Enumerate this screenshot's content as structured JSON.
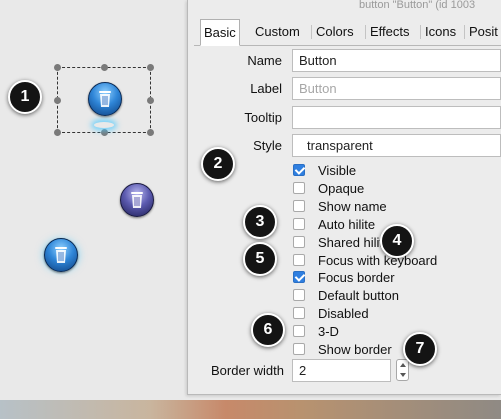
{
  "window": {
    "title": "button \"Button\" (id 1003"
  },
  "tabs": [
    "Basic",
    "Custom",
    "Colors",
    "Effects",
    "Icons",
    "Posit"
  ],
  "active_tab": "Basic",
  "fields": {
    "name": {
      "label": "Name",
      "value": "Button"
    },
    "label": {
      "label": "Label",
      "placeholder": "Button"
    },
    "tooltip": {
      "label": "Tooltip",
      "value": ""
    },
    "style": {
      "label": "Style",
      "value": "transparent"
    },
    "border_width": {
      "label": "Border width",
      "value": "2"
    }
  },
  "checkboxes": [
    {
      "label": "Visible",
      "checked": true
    },
    {
      "label": "Opaque",
      "checked": false
    },
    {
      "label": "Show name",
      "checked": false
    },
    {
      "label": "Auto hilite",
      "checked": false
    },
    {
      "label": "Shared hilite",
      "checked": false
    },
    {
      "label": "Focus with keyboard",
      "checked": false
    },
    {
      "label": "Focus border",
      "checked": true
    },
    {
      "label": "Default button",
      "checked": false
    },
    {
      "label": "Disabled",
      "checked": false
    },
    {
      "label": "3-D",
      "checked": false
    },
    {
      "label": "Show border",
      "checked": false
    }
  ],
  "callouts": [
    "1",
    "2",
    "3",
    "4",
    "5",
    "6",
    "7"
  ],
  "canvas_buttons": [
    {
      "icon": "trash-icon",
      "color": "#2f86d8",
      "selected": true
    },
    {
      "icon": "trash-icon",
      "color": "#5c5bb0",
      "selected": false
    },
    {
      "icon": "trash-icon",
      "color": "#2f86d8",
      "selected": false
    }
  ],
  "colors": {
    "checkbox_on": "#2f7fe0",
    "callout_bg": "#141414"
  }
}
